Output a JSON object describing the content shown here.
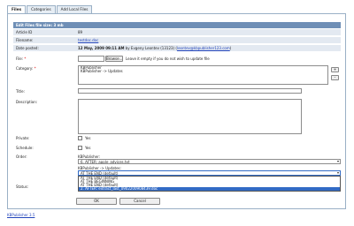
{
  "tabs": [
    {
      "label": "Files",
      "active": true
    },
    {
      "label": "Categories",
      "active": false
    },
    {
      "label": "Add Local Files",
      "active": false
    }
  ],
  "form_title": "Edit Files file size: 3 mb",
  "info": {
    "article_id": {
      "label": "Article ID",
      "value": "89"
    },
    "filename": {
      "label": "Filename:",
      "value": "testdoc.doc"
    },
    "date_posted": {
      "label": "Date posted:",
      "date": "12 May, 2009 09:11 AM",
      "by": "by Evgeny Leontev (13123)",
      "email": "leontev@kbpublisher123.com"
    }
  },
  "file": {
    "label": "File:",
    "required_mark": "*",
    "browse_label": "Browse...",
    "hint": "Leave it empty if you do not wish to update file"
  },
  "category": {
    "label": "Category:",
    "required_mark": "*",
    "items": [
      "KBPublisher",
      "KBPublisher -> Updates"
    ],
    "add_label": "+",
    "remove_label": "-"
  },
  "title_label": "Title:",
  "description_label": "Description:",
  "private": {
    "label": "Private:",
    "yes_label": "Yes"
  },
  "schedule": {
    "label": "Schedule:",
    "yes_label": "Yes"
  },
  "order": {
    "label": "Order:",
    "group1_label": "KBPublisher:",
    "group1_value": "6. AFTER: apple_advices.txt",
    "group2_label": "KBPublisher -> Updates:",
    "group2_value": "AT THE END (default)",
    "dropdown_options": [
      {
        "label": "AT THE END (default)",
        "selected": false
      },
      {
        "label": "AT THE BEGINNING",
        "selected": false
      },
      {
        "label": "AT THE END (default)",
        "selected": false
      },
      {
        "label": "2. AFTER: extract_last_0902200908439.doc",
        "selected": true
      }
    ]
  },
  "status_label": "Status:",
  "ok_label": "OK",
  "cancel_label": "Cancel",
  "footer_link": "KBPublisher 3.5",
  "colors": {
    "header": "#6f8fb6",
    "shaded_row": "#e3e9f1",
    "selection": "#316ac5"
  }
}
